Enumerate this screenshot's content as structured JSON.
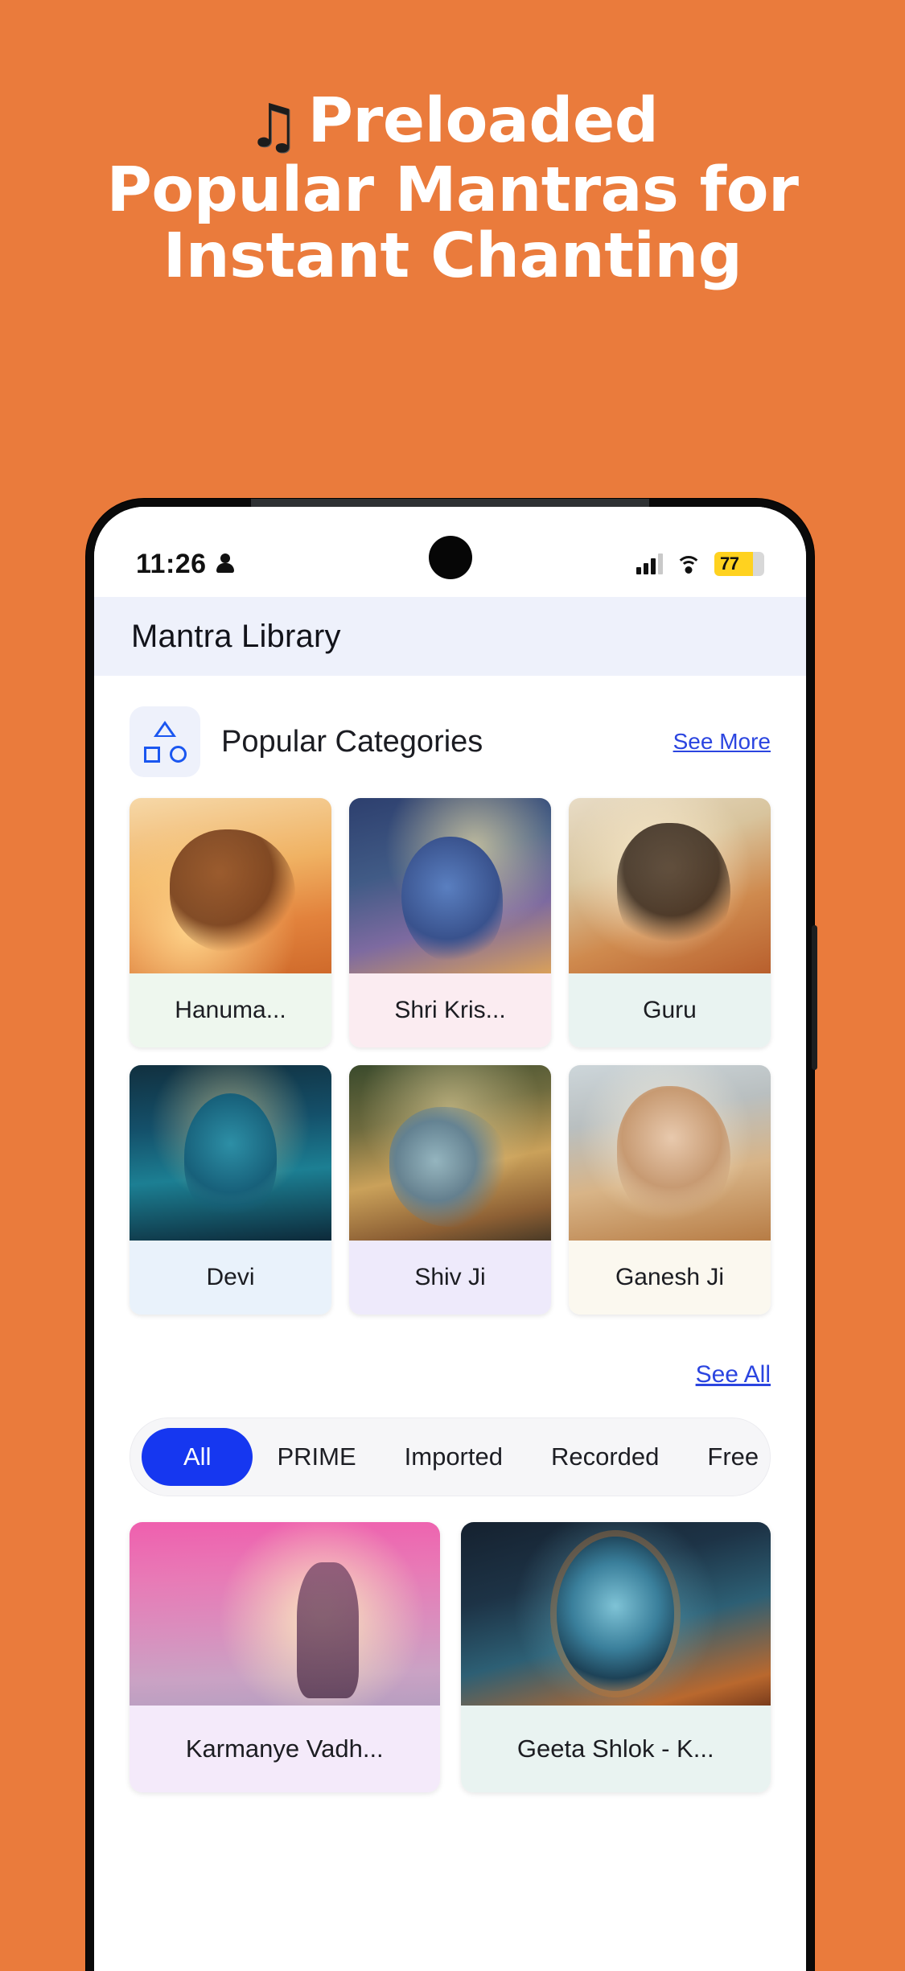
{
  "promo": {
    "music_note_icon": "music-note-icon",
    "line1": "Preloaded",
    "line2": "Popular Mantras for",
    "line3": "Instant Chanting",
    "background_color": "#ea7b3c",
    "text_color": "#ffffff"
  },
  "statusbar": {
    "time": "11:26",
    "person_icon": "person-icon",
    "signal_icon": "signal-bars-icon",
    "wifi_icon": "wifi-icon",
    "battery_level": "77",
    "battery_color": "#ffd21f"
  },
  "appbar": {
    "title": "Mantra Library",
    "background_color": "#eef1fb"
  },
  "categories_section": {
    "icon": "shapes-icon",
    "title": "Popular Categories",
    "see_more_label": "See More",
    "link_color": "#2b45e0",
    "cards": [
      {
        "label": "Hanuma...",
        "art": "art-hanuman",
        "label_bg": "#eef7ee"
      },
      {
        "label": "Shri Kris...",
        "art": "art-krishna",
        "label_bg": "#fbecf1"
      },
      {
        "label": "Guru",
        "art": "art-guru",
        "label_bg": "#e9f3f1"
      },
      {
        "label": "Devi",
        "art": "art-devi",
        "label_bg": "#e9f2fb"
      },
      {
        "label": "Shiv Ji",
        "art": "art-shiv",
        "label_bg": "#eeeafb"
      },
      {
        "label": "Ganesh Ji",
        "art": "art-ganesh",
        "label_bg": "#fbf8ef"
      }
    ],
    "see_all_label": "See All"
  },
  "filters": {
    "chips": [
      {
        "label": "All",
        "active": true
      },
      {
        "label": "PRIME",
        "active": false
      },
      {
        "label": "Imported",
        "active": false
      },
      {
        "label": "Recorded",
        "active": false
      },
      {
        "label": "Free",
        "active": false
      }
    ],
    "active_color": "#1637f0"
  },
  "mantras": [
    {
      "label": "Karmanye Vadh...",
      "art": "art-karmanye",
      "label_bg": "#f4eafa"
    },
    {
      "label": "Geeta Shlok - K...",
      "art": "art-geeta",
      "label_bg": "#e9f3f1"
    }
  ]
}
